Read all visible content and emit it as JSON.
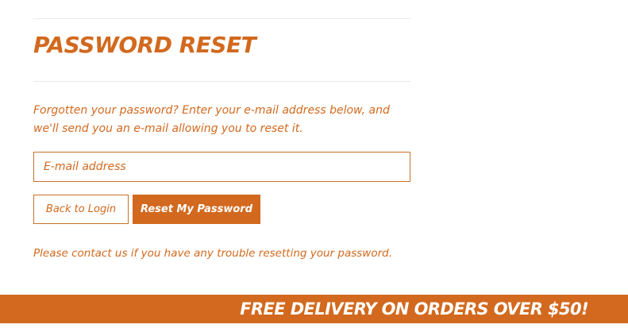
{
  "reset_form": {
    "title": "PASSWORD RESET",
    "instructions_line1": "Forgotten your password? Enter your e-mail address below, and",
    "instructions_line2": "we'll send you an e-mail allowing you to reset it.",
    "email_placeholder": "E-mail address",
    "email_value": "",
    "back_label": "Back to Login",
    "reset_label": "Reset My Password",
    "contact_note": "Please contact us if you have any trouble resetting your password."
  },
  "promo_banner": {
    "text": "FREE DELIVERY ON ORDERS OVER $50!"
  },
  "colors": {
    "accent": "#d2691e",
    "divider": "#e9e9e9",
    "background": "#ffffff"
  }
}
